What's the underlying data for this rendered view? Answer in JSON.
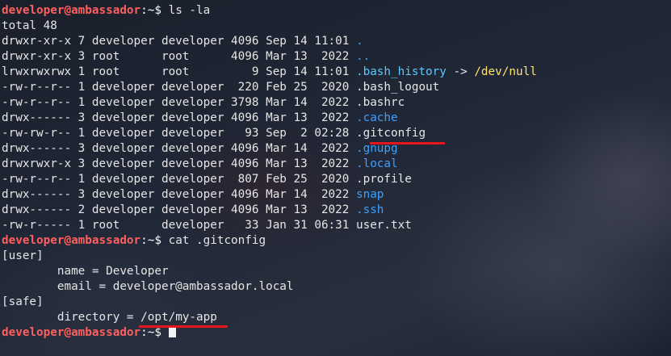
{
  "prompt": {
    "user_host": "developer@ambassador",
    "path_suffix": ":~$ "
  },
  "commands": {
    "ls": "ls -la",
    "cat": "cat .gitconfig"
  },
  "ls_output": {
    "total": "total 48",
    "rows": [
      {
        "perms": "drwxr-xr-x 7 developer developer 4096 Sep 14 11:01 ",
        "name": ".",
        "type": "dir"
      },
      {
        "perms": "drwxr-xr-x 3 root      root      4096 Mar 13  2022 ",
        "name": "..",
        "type": "dir"
      },
      {
        "perms": "lrwxrwxrwx 1 root      root         9 Sep 14 11:01 ",
        "name": ".bash_history",
        "type": "link",
        "arrow": " -> ",
        "target": "/dev/null"
      },
      {
        "perms": "-rw-r--r-- 1 developer developer  220 Feb 25  2020 ",
        "name": ".bash_logout",
        "type": "file"
      },
      {
        "perms": "-rw-r--r-- 1 developer developer 3798 Mar 14  2022 ",
        "name": ".bashrc",
        "type": "file"
      },
      {
        "perms": "drwx------ 3 developer developer 4096 Mar 13  2022 ",
        "name": ".cache",
        "type": "dir"
      },
      {
        "perms": "-rw-rw-r-- 1 developer developer   93 Sep  2 02:28 ",
        "name": ".gitconfig",
        "type": "file"
      },
      {
        "perms": "drwx------ 3 developer developer 4096 Mar 14  2022 ",
        "name": ".gnupg",
        "type": "dir"
      },
      {
        "perms": "drwxrwxr-x 3 developer developer 4096 Mar 13  2022 ",
        "name": ".local",
        "type": "dir"
      },
      {
        "perms": "-rw-r--r-- 1 developer developer  807 Feb 25  2020 ",
        "name": ".profile",
        "type": "file"
      },
      {
        "perms": "drwx------ 3 developer developer 4096 Mar 14  2022 ",
        "name": "snap",
        "type": "dir"
      },
      {
        "perms": "drwx------ 2 developer developer 4096 Mar 13  2022 ",
        "name": ".ssh",
        "type": "dir"
      },
      {
        "perms": "-rw-r----- 1 root      developer   33 Jan 31 06:31 ",
        "name": "user.txt",
        "type": "file"
      }
    ]
  },
  "gitconfig": {
    "user_header": "[user]",
    "name_line": "        name = Developer",
    "email_line": "        email = developer@ambassador.local",
    "safe_header": "[safe]",
    "directory_prefix": "        directory = ",
    "directory_value": "/opt/my-app"
  },
  "colors": {
    "prompt_user": "#ff5f5f",
    "directory": "#3da0ff",
    "symlink": "#5cc8ff",
    "symlink_target": "#ffe36e",
    "highlight_underline": "#e8161c"
  }
}
